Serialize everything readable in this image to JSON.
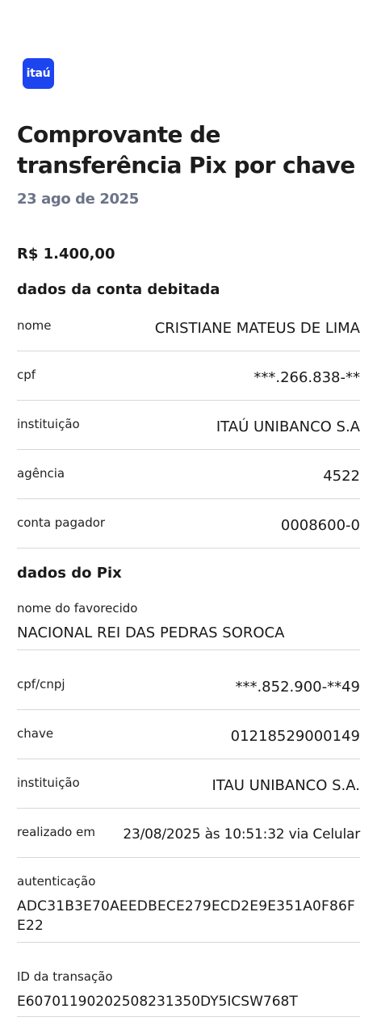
{
  "brand": {
    "logo_text": "itaú",
    "color": "#1c45f0"
  },
  "header": {
    "title": "Comprovante de transferência Pix por chave",
    "date": "23 ago de 2025"
  },
  "amount": "R$ 1.400,00",
  "debit_account": {
    "heading": "dados da conta debitada",
    "rows": [
      {
        "label": "nome",
        "value": "CRISTIANE MATEUS DE LIMA"
      },
      {
        "label": "cpf",
        "value": "***.266.838-**"
      },
      {
        "label": "instituição",
        "value": "ITAÚ UNIBANCO S.A"
      },
      {
        "label": "agência",
        "value": "4522"
      },
      {
        "label": "conta pagador",
        "value": "0008600-0"
      }
    ]
  },
  "pix": {
    "heading": "dados do Pix",
    "beneficiary": {
      "label": "nome do favorecido",
      "value": "NACIONAL REI DAS PEDRAS SOROCA"
    },
    "rows": [
      {
        "label": "cpf/cnpj",
        "value": "***.852.900-**49"
      },
      {
        "label": "chave",
        "value": "01218529000149"
      },
      {
        "label": "instituição",
        "value": "ITAU UNIBANCO S.A."
      },
      {
        "label": "realizado em",
        "value": "23/08/2025 às 10:51:32 via Celular"
      }
    ],
    "authentication": {
      "label": "autenticação",
      "value": "ADC31B3E70AEEDBECE279ECD2E9E351A0F86FE22"
    },
    "transaction_id": {
      "label": "ID da transação",
      "value": "E60701190202508231350DY5ICSW768T"
    }
  }
}
